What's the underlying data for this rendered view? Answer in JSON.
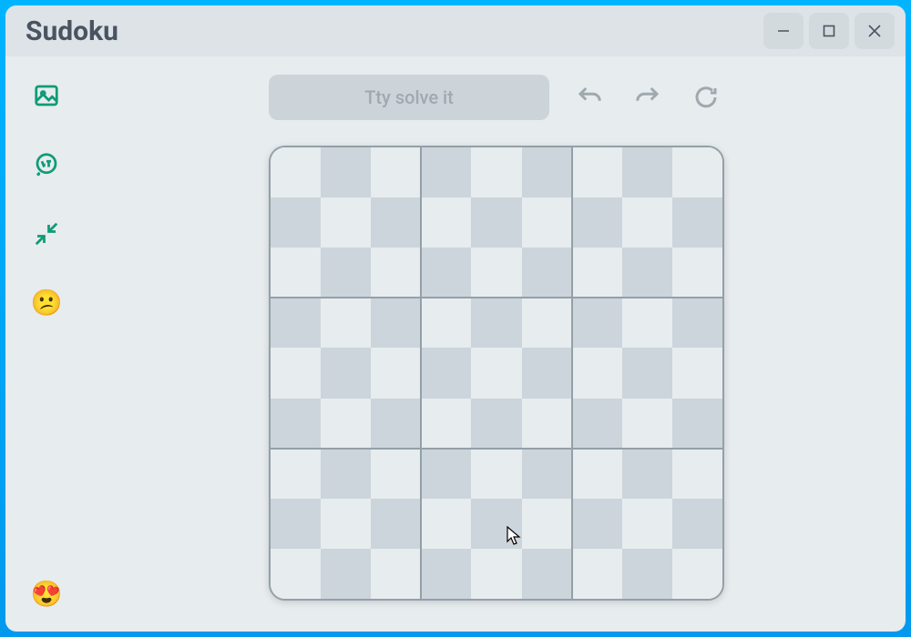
{
  "window": {
    "title": "Sudoku"
  },
  "toolbar": {
    "solve_label": "Tty solve it",
    "undo_name": "undo",
    "redo_name": "redo",
    "reset_name": "reset"
  },
  "sidebar": {
    "items": [
      {
        "name": "image-icon"
      },
      {
        "name": "translate-icon"
      },
      {
        "name": "collapse-icon"
      },
      {
        "name": "confused-emoji",
        "glyph": "😕"
      }
    ],
    "bottom": {
      "name": "pleased-emoji",
      "glyph": "😍"
    }
  },
  "board": {
    "size": 9,
    "cells": []
  },
  "colors": {
    "accent": "#0f9b77",
    "muted": "#9fa9af",
    "border": "#94a0a8",
    "shade": "#ccd5db",
    "light": "#e7ecef"
  }
}
